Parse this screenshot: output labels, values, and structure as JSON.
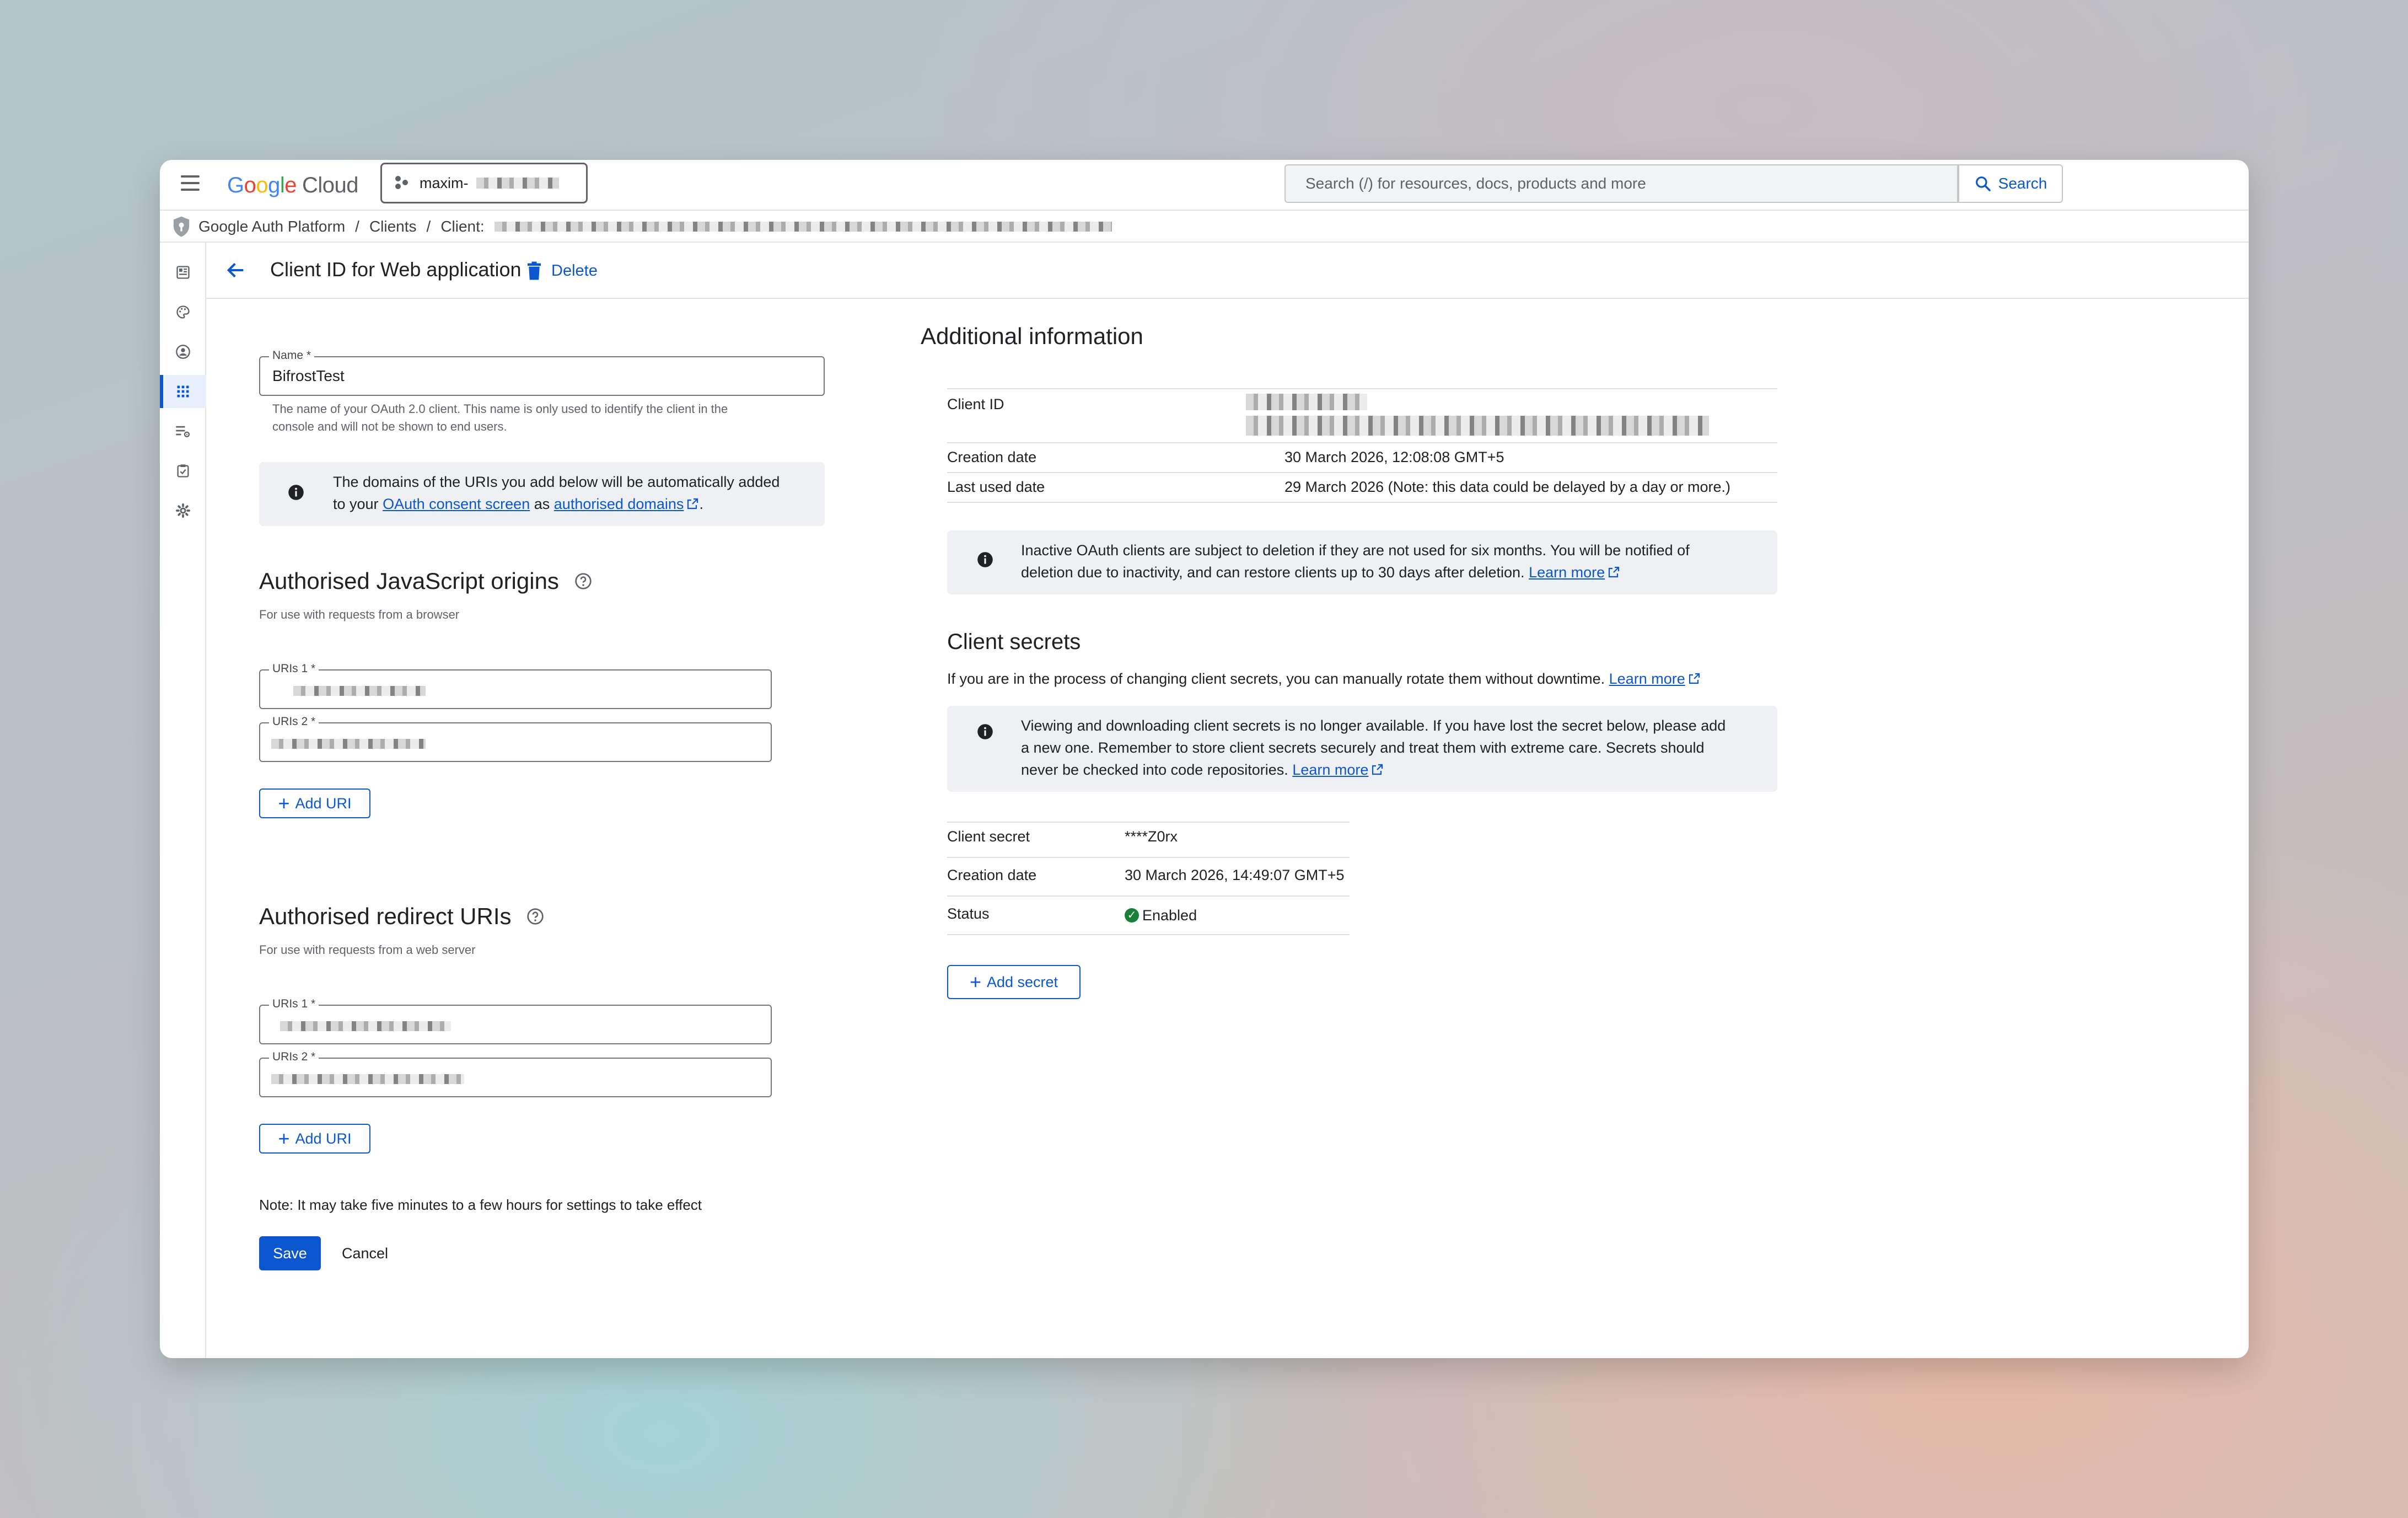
{
  "topbar": {
    "logo_google": "Google",
    "logo_cloud": "Cloud",
    "project_name": "maxim-",
    "search_placeholder": "Search (/) for resources, docs, products and more",
    "search_button": "Search"
  },
  "breadcrumb": {
    "items": [
      "Google Auth Platform",
      "Clients",
      "Client:"
    ],
    "separator": "/"
  },
  "rail": {
    "items": [
      "dashboard-icon",
      "branding-icon",
      "audience-icon",
      "clients-icon",
      "data-access-icon",
      "verification-icon",
      "settings-icon"
    ],
    "active_index": 3
  },
  "header": {
    "title": "Client ID for Web application",
    "delete_label": "Delete"
  },
  "form": {
    "name_label": "Name *",
    "name_value": "BifrostTest",
    "name_helper_1": "The name of your OAuth 2.0 client. This name is only used to identify the client in the",
    "name_helper_2": "console and will not be shown to end users.",
    "domains_info_1": "The domains of the URIs you add below will be automatically added",
    "domains_info_2": "to your",
    "domains_link_1": "OAuth consent screen",
    "domains_info_3": "as",
    "domains_link_2": "authorised domains",
    "js_origins": {
      "title": "Authorised JavaScript origins",
      "subtitle": "For use with requests from a browser",
      "uri1_label": "URIs 1 *",
      "uri2_label": "URIs 2 *",
      "add_label": "Add URI"
    },
    "redirect_uris": {
      "title": "Authorised redirect URIs",
      "subtitle": "For use with requests from a web server",
      "uri1_label": "URIs 1 *",
      "uri2_label": "URIs 2 *",
      "add_label": "Add URI"
    },
    "note": "Note: It may take five minutes to a few hours for settings to take effect",
    "save_label": "Save",
    "cancel_label": "Cancel"
  },
  "additional": {
    "title": "Additional information",
    "client_id_label": "Client ID",
    "creation_date_label": "Creation date",
    "creation_date_value": "30 March 2026, 12:08:08 GMT+5",
    "last_used_label": "Last used date",
    "last_used_value": "29 March 2026 (Note: this data could be delayed by a day or more.)",
    "inactive_info_1": "Inactive OAuth clients are subject to deletion if they are not used for six months. You will be notified of",
    "inactive_info_2": "deletion due to inactivity, and can restore clients up to 30 days after deletion.",
    "learn_more": "Learn more"
  },
  "secrets": {
    "title": "Client secrets",
    "subtitle": "If you are in the process of changing client secrets, you can manually rotate them without downtime.",
    "learn_more": "Learn more",
    "info_1": "Viewing and downloading client secrets is no longer available. If you have lost the secret below, please add",
    "info_2": "a new one. Remember to store client secrets securely and treat them with extreme care. Secrets should",
    "info_3": "never be checked into code repositories.",
    "info_learn_more": "Learn more",
    "secret_label": "Client secret",
    "secret_value": "****Z0rx",
    "creation_date_label": "Creation date",
    "creation_date_value": "30 March 2026, 14:49:07 GMT+5",
    "status_label": "Status",
    "status_value": "Enabled",
    "add_label": "Add secret"
  },
  "colors": {
    "accent": "#0b57d0",
    "status_ok": "#188038",
    "info_bg": "#eef0f3"
  }
}
